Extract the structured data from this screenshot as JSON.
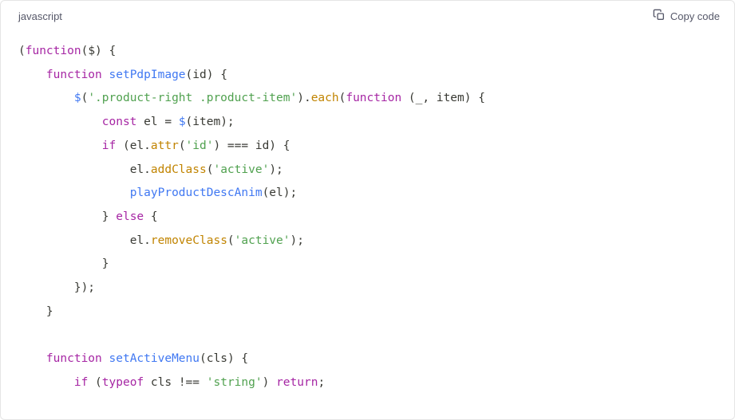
{
  "header": {
    "language": "javascript",
    "copy_label": "Copy code"
  },
  "code": {
    "tokens": [
      [
        {
          "c": "punct",
          "t": "("
        },
        {
          "c": "keyword",
          "t": "function"
        },
        {
          "c": "punct",
          "t": "("
        },
        {
          "c": "param",
          "t": "$"
        },
        {
          "c": "punct",
          "t": ") {"
        }
      ],
      [
        {
          "c": "indent",
          "t": "    "
        },
        {
          "c": "keyword",
          "t": "function"
        },
        {
          "c": "space",
          "t": " "
        },
        {
          "c": "fn-def",
          "t": "setPdpImage"
        },
        {
          "c": "punct",
          "t": "("
        },
        {
          "c": "param",
          "t": "id"
        },
        {
          "c": "punct",
          "t": ") {"
        }
      ],
      [
        {
          "c": "indent",
          "t": "        "
        },
        {
          "c": "fn-call",
          "t": "$"
        },
        {
          "c": "punct",
          "t": "("
        },
        {
          "c": "string",
          "t": "'.product-right .product-item'"
        },
        {
          "c": "punct",
          "t": ")."
        },
        {
          "c": "method",
          "t": "each"
        },
        {
          "c": "punct",
          "t": "("
        },
        {
          "c": "keyword",
          "t": "function"
        },
        {
          "c": "space",
          "t": " "
        },
        {
          "c": "punct",
          "t": "("
        },
        {
          "c": "param",
          "t": "_, item"
        },
        {
          "c": "punct",
          "t": ") {"
        }
      ],
      [
        {
          "c": "indent",
          "t": "            "
        },
        {
          "c": "keyword",
          "t": "const"
        },
        {
          "c": "space",
          "t": " "
        },
        {
          "c": "ident",
          "t": "el = "
        },
        {
          "c": "fn-call",
          "t": "$"
        },
        {
          "c": "punct",
          "t": "(item);"
        }
      ],
      [
        {
          "c": "indent",
          "t": "            "
        },
        {
          "c": "keyword",
          "t": "if"
        },
        {
          "c": "space",
          "t": " "
        },
        {
          "c": "punct",
          "t": "(el."
        },
        {
          "c": "method",
          "t": "attr"
        },
        {
          "c": "punct",
          "t": "("
        },
        {
          "c": "string",
          "t": "'id'"
        },
        {
          "c": "punct",
          "t": ") === id) {"
        }
      ],
      [
        {
          "c": "indent",
          "t": "                "
        },
        {
          "c": "ident",
          "t": "el."
        },
        {
          "c": "method",
          "t": "addClass"
        },
        {
          "c": "punct",
          "t": "("
        },
        {
          "c": "string",
          "t": "'active'"
        },
        {
          "c": "punct",
          "t": ");"
        }
      ],
      [
        {
          "c": "indent",
          "t": "                "
        },
        {
          "c": "fn-call",
          "t": "playProductDescAnim"
        },
        {
          "c": "punct",
          "t": "(el);"
        }
      ],
      [
        {
          "c": "indent",
          "t": "            "
        },
        {
          "c": "punct",
          "t": "} "
        },
        {
          "c": "keyword",
          "t": "else"
        },
        {
          "c": "punct",
          "t": " {"
        }
      ],
      [
        {
          "c": "indent",
          "t": "                "
        },
        {
          "c": "ident",
          "t": "el."
        },
        {
          "c": "method",
          "t": "removeClass"
        },
        {
          "c": "punct",
          "t": "("
        },
        {
          "c": "string",
          "t": "'active'"
        },
        {
          "c": "punct",
          "t": ");"
        }
      ],
      [
        {
          "c": "indent",
          "t": "            "
        },
        {
          "c": "punct",
          "t": "}"
        }
      ],
      [
        {
          "c": "indent",
          "t": "        "
        },
        {
          "c": "punct",
          "t": "});"
        }
      ],
      [
        {
          "c": "indent",
          "t": "    "
        },
        {
          "c": "punct",
          "t": "}"
        }
      ],
      [
        {
          "c": "blank",
          "t": ""
        }
      ],
      [
        {
          "c": "indent",
          "t": "    "
        },
        {
          "c": "keyword",
          "t": "function"
        },
        {
          "c": "space",
          "t": " "
        },
        {
          "c": "fn-def",
          "t": "setActiveMenu"
        },
        {
          "c": "punct",
          "t": "("
        },
        {
          "c": "param",
          "t": "cls"
        },
        {
          "c": "punct",
          "t": ") {"
        }
      ],
      [
        {
          "c": "indent",
          "t": "        "
        },
        {
          "c": "keyword",
          "t": "if"
        },
        {
          "c": "space",
          "t": " "
        },
        {
          "c": "punct",
          "t": "("
        },
        {
          "c": "keyword",
          "t": "typeof"
        },
        {
          "c": "space",
          "t": " "
        },
        {
          "c": "ident",
          "t": "cls !== "
        },
        {
          "c": "string",
          "t": "'string'"
        },
        {
          "c": "punct",
          "t": ") "
        },
        {
          "c": "keyword",
          "t": "return"
        },
        {
          "c": "punct",
          "t": ";"
        }
      ]
    ]
  }
}
